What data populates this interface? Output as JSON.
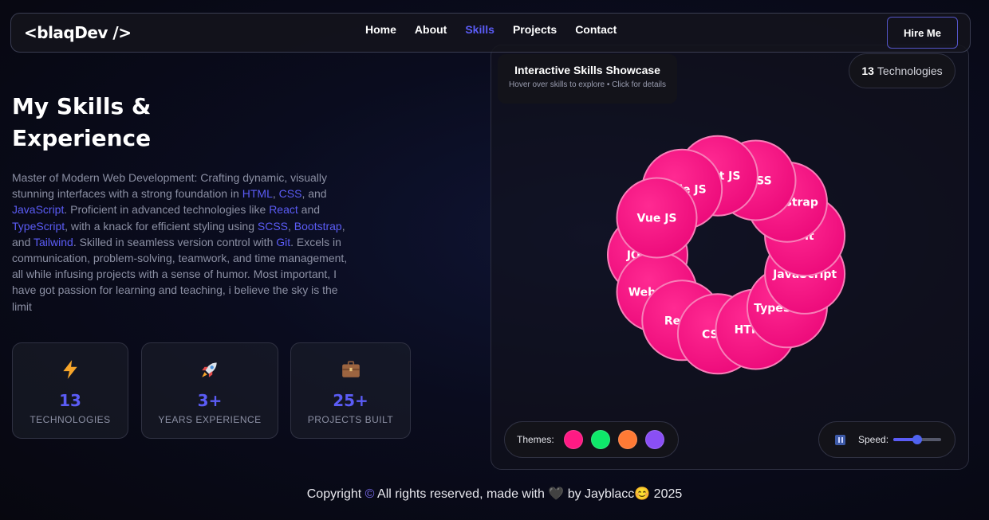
{
  "nav": {
    "logo": "<blaqDev />",
    "links": [
      "Home",
      "About",
      "Skills",
      "Projects",
      "Contact"
    ],
    "active_index": 2,
    "hire_label": "Hire Me"
  },
  "hero": {
    "title_line1": "My Skills &",
    "title_line2": "Experience",
    "bio": [
      {
        "t": "Master of Modern Web Development: Crafting dynamic, visually stunning interfaces with a strong foundation in ",
        "h": false
      },
      {
        "t": "HTML",
        "h": true
      },
      {
        "t": ", ",
        "h": false
      },
      {
        "t": "CSS",
        "h": true
      },
      {
        "t": ", and ",
        "h": false
      },
      {
        "t": "JavaScript",
        "h": true
      },
      {
        "t": ". Proficient in advanced technologies like ",
        "h": false
      },
      {
        "t": "React",
        "h": true
      },
      {
        "t": " and ",
        "h": false
      },
      {
        "t": "TypeScript",
        "h": true
      },
      {
        "t": ", with a knack for efficient styling using ",
        "h": false
      },
      {
        "t": "SCSS",
        "h": true
      },
      {
        "t": ", ",
        "h": false
      },
      {
        "t": "Bootstrap",
        "h": true
      },
      {
        "t": ", and ",
        "h": false
      },
      {
        "t": "Tailwind",
        "h": true
      },
      {
        "t": ". Skilled in seamless version control with ",
        "h": false
      },
      {
        "t": "Git",
        "h": true
      },
      {
        "t": ". Excels in communication, problem-solving, teamwork, and time management, all while infusing projects with a sense of humor. Most important, I have got passion for learning and teaching, i believe the sky is the limit",
        "h": false
      }
    ]
  },
  "stats": [
    {
      "icon": "lightning-icon",
      "value": "13",
      "label": "TECHNOLOGIES"
    },
    {
      "icon": "rocket-icon",
      "value": "3+",
      "label": "YEARS EXPERIENCE"
    },
    {
      "icon": "briefcase-icon",
      "value": "25+",
      "label": "PROJECTS BUILT"
    }
  ],
  "showcase": {
    "title": "Interactive Skills Showcase",
    "subtitle": "Hover over skills to explore • Click for details",
    "badge_count": "13",
    "badge_label": "Technologies",
    "skills": [
      "JQuery",
      "Webpack",
      "React",
      "CSS3",
      "HTML5",
      "TypeScript",
      "JavaScript",
      "Git",
      "Bootstrap",
      "SASS",
      "Next JS",
      "Node JS",
      "Vue JS"
    ],
    "bubble_color": "#ec0a7a",
    "themes_label": "Themes:",
    "theme_colors": [
      "#ff1a84",
      "#0ee86a",
      "#ff7a35",
      "#8a4ff5"
    ],
    "speed_label": "Speed:",
    "speed_level": 0.5
  },
  "footer": {
    "before": "Copyright ",
    "copyright_symbol": "©",
    "middle": " All rights reserved, made with ",
    "heart": "🖤",
    "by": " by Jayblacc",
    "emoji": "😊",
    "year": " 2025"
  }
}
